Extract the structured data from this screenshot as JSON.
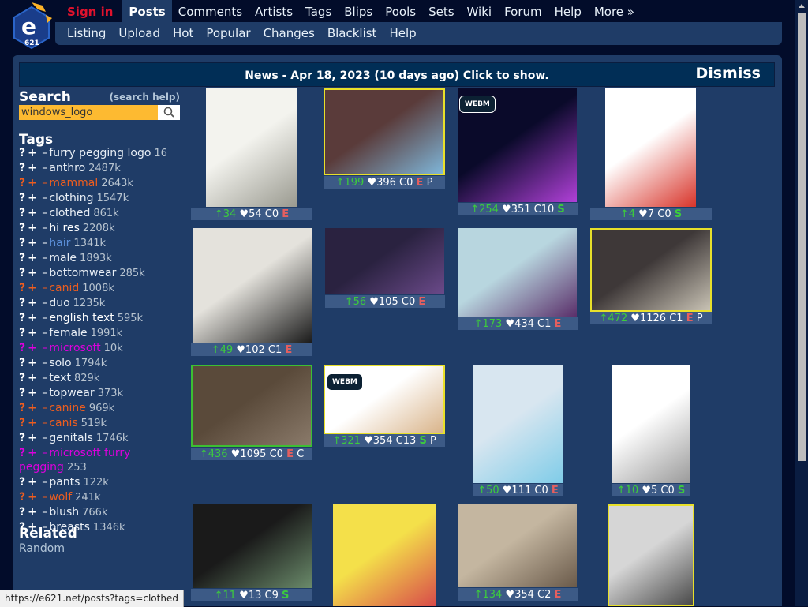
{
  "nav": {
    "signin": "Sign in",
    "tabs": [
      "Posts",
      "Comments",
      "Artists",
      "Tags",
      "Blips",
      "Pools",
      "Sets",
      "Wiki",
      "Forum",
      "Help",
      "More »"
    ],
    "subtabs": [
      "Listing",
      "Upload",
      "Hot",
      "Popular",
      "Changes",
      "Blacklist",
      "Help"
    ]
  },
  "news": {
    "text": "News - Apr 18, 2023 (10 days ago) Click to show.",
    "dismiss": "Dismiss"
  },
  "search": {
    "title": "Search",
    "help": "(search help)",
    "value": "windows_logo"
  },
  "tags_title": "Tags",
  "tags": [
    {
      "name": "furry pegging logo",
      "count": "16",
      "cat": "gen"
    },
    {
      "name": "anthro",
      "count": "2487k",
      "cat": "gen"
    },
    {
      "name": "mammal",
      "count": "2643k",
      "cat": "spe"
    },
    {
      "name": "clothing",
      "count": "1547k",
      "cat": "gen"
    },
    {
      "name": "clothed",
      "count": "861k",
      "cat": "gen",
      "link": true
    },
    {
      "name": "hi res",
      "count": "2208k",
      "cat": "met"
    },
    {
      "name": "hair",
      "count": "1341k",
      "cat": "gen"
    },
    {
      "name": "male",
      "count": "1893k",
      "cat": "gen"
    },
    {
      "name": "bottomwear",
      "count": "285k",
      "cat": "gen"
    },
    {
      "name": "canid",
      "count": "1008k",
      "cat": "spe"
    },
    {
      "name": "duo",
      "count": "1235k",
      "cat": "gen"
    },
    {
      "name": "english text",
      "count": "595k",
      "cat": "met"
    },
    {
      "name": "female",
      "count": "1991k",
      "cat": "gen"
    },
    {
      "name": "microsoft",
      "count": "10k",
      "cat": "cop"
    },
    {
      "name": "solo",
      "count": "1794k",
      "cat": "gen"
    },
    {
      "name": "text",
      "count": "829k",
      "cat": "gen"
    },
    {
      "name": "topwear",
      "count": "373k",
      "cat": "gen"
    },
    {
      "name": "canine",
      "count": "969k",
      "cat": "spe"
    },
    {
      "name": "canis",
      "count": "519k",
      "cat": "spe"
    },
    {
      "name": "genitals",
      "count": "1746k",
      "cat": "gen"
    },
    {
      "name": "microsoft furry pegging",
      "count": "253",
      "cat": "cop",
      "wrap": true
    },
    {
      "name": "pants",
      "count": "122k",
      "cat": "gen"
    },
    {
      "name": "wolf",
      "count": "241k",
      "cat": "spe"
    },
    {
      "name": "blush",
      "count": "766k",
      "cat": "gen"
    },
    {
      "name": "breasts",
      "count": "1346k",
      "cat": "gen"
    }
  ],
  "related": {
    "title": "Related",
    "random": "Random"
  },
  "posts": [
    {
      "score": "↑34",
      "favs": "♥54",
      "comments": "C0",
      "rating": "E",
      "flag": "",
      "webm": false
    },
    {
      "score": "↑199",
      "favs": "♥396",
      "comments": "C0",
      "rating": "E",
      "flag": "P",
      "webm": false
    },
    {
      "score": "↑254",
      "favs": "♥351",
      "comments": "C10",
      "rating": "S",
      "flag": "",
      "webm": true
    },
    {
      "score": "↑4",
      "favs": "♥7",
      "comments": "C0",
      "rating": "S",
      "flag": "",
      "webm": false
    },
    {
      "score": "↑49",
      "favs": "♥102",
      "comments": "C1",
      "rating": "E",
      "flag": "",
      "webm": false
    },
    {
      "score": "↑56",
      "favs": "♥105",
      "comments": "C0",
      "rating": "E",
      "flag": "",
      "webm": false
    },
    {
      "score": "↑173",
      "favs": "♥434",
      "comments": "C1",
      "rating": "E",
      "flag": "",
      "webm": false
    },
    {
      "score": "↑472",
      "favs": "♥1126",
      "comments": "C1",
      "rating": "E",
      "flag": "P",
      "webm": false
    },
    {
      "score": "↑436",
      "favs": "♥1095",
      "comments": "C0",
      "rating": "E",
      "flag": "C",
      "webm": false
    },
    {
      "score": "↑321",
      "favs": "♥354",
      "comments": "C13",
      "rating": "S",
      "flag": "P",
      "webm": true
    },
    {
      "score": "↑50",
      "favs": "♥111",
      "comments": "C0",
      "rating": "E",
      "flag": "",
      "webm": false
    },
    {
      "score": "↑10",
      "favs": "♥5",
      "comments": "C0",
      "rating": "S",
      "flag": "",
      "webm": false
    },
    {
      "score": "↑11",
      "favs": "♥13",
      "comments": "C9",
      "rating": "S",
      "flag": "",
      "webm": false
    },
    {
      "score": "",
      "favs": "",
      "comments": "",
      "rating": "",
      "flag": "",
      "webm": false
    },
    {
      "score": "↑134",
      "favs": "♥354",
      "comments": "C2",
      "rating": "E",
      "flag": "",
      "webm": false
    },
    {
      "score": "",
      "favs": "",
      "comments": "",
      "rating": "",
      "flag": "",
      "webm": false
    }
  ],
  "webm_label": "WEBM",
  "status_url": "https://e621.net/posts?tags=clothed"
}
